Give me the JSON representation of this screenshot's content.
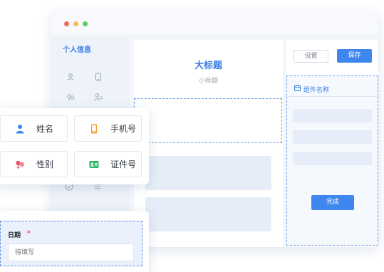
{
  "sidebar": {
    "title": "个人信息",
    "icons": [
      "person-icon",
      "phone-outline-icon",
      "gender-icon",
      "id-card-outline-icon",
      "check-circle-icon",
      "list-icon"
    ]
  },
  "canvas": {
    "title": "大标题",
    "subtitle": "小标题"
  },
  "toolbar": {
    "settings_label": "设置",
    "save_label": "保存"
  },
  "properties": {
    "title": "组件名称",
    "icon": "calendar-icon",
    "done_label": "完成"
  },
  "palette": {
    "items": [
      {
        "label": "姓名",
        "icon": "person-icon",
        "color": "#3e87ef"
      },
      {
        "label": "手机号",
        "icon": "phone-icon",
        "color": "#f59a2e"
      },
      {
        "label": "性别",
        "icon": "gender-icon",
        "color": "#e8566a"
      },
      {
        "label": "证件号",
        "icon": "id-card-icon",
        "color": "#33b46a"
      }
    ]
  },
  "date_field": {
    "label": "日期",
    "required_mark": "*",
    "placeholder": "待填写"
  },
  "colors": {
    "accent": "#3e87ef",
    "required": "#e84545"
  }
}
